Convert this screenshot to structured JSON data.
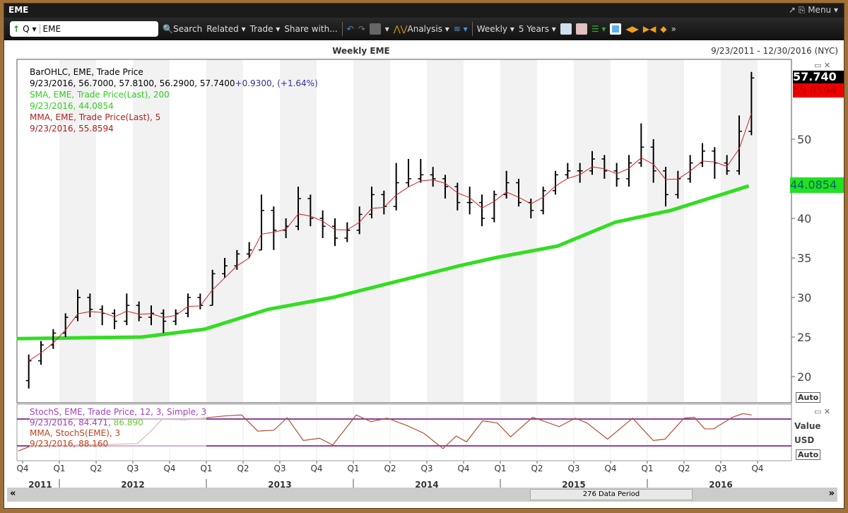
{
  "window": {
    "title": "EME",
    "menu": "Menu"
  },
  "toolbar": {
    "ticker": "EME",
    "quote_mode": "Q",
    "search": "Search",
    "related": "Related",
    "trade": "Trade",
    "share": "Share with...",
    "analysis": "Analysis",
    "period": "Weekly",
    "range": "5 Years"
  },
  "header": {
    "title": "Weekly EME",
    "date_range": "9/23/2011 - 12/30/2016 (NYC)"
  },
  "legend": {
    "price_title": "BarOHLC, EME, Trade Price",
    "price_values": "9/23/2016, 56.7000, 57.8100, 56.2900, 57.7400",
    "price_change": "+0.9300, (+1.64%)",
    "sma_title": "SMA, EME, Trade Price(Last),  200",
    "sma_value": "9/23/2016, 44.0854",
    "mma_title": "MMA, EME, Trade Price(Last),  5",
    "mma_value": "9/23/2016, 55.8594",
    "stoch_title": "StochS, EME, Trade Price,  12, 3, Simple, 3",
    "stoch_value_a": "9/23/2016, 84.471,",
    "stoch_value_b": "86.890",
    "stoch_mma_title": "MMA, StochS(EME),  3",
    "stoch_mma_value": "9/23/2016, 88.160"
  },
  "axis": {
    "last_price": "57.740",
    "mma_tag": "55.8594",
    "sma_tag": "44.0854",
    "auto": "Auto",
    "lower_value": "Value",
    "lower_usd": "USD"
  },
  "footer": {
    "data_period": "276 Data Period"
  },
  "colors": {
    "price": "#000000",
    "sma": "#33dd22",
    "mma": "#cc2222",
    "stoch": "#b05030",
    "band": "#9040a0"
  },
  "chart_data": {
    "type": "ohlc",
    "title": "Weekly EME",
    "frequency_shown": "monthly approximation of weekly bars",
    "start_month": "2011-10",
    "ylim": [
      18,
      59
    ],
    "yticks": [
      20,
      25,
      30,
      35,
      40,
      50
    ],
    "xticks": [
      "Q4",
      "Q1",
      "Q2",
      "Q3",
      "Q4",
      "Q1",
      "Q2",
      "Q3",
      "Q4",
      "Q1",
      "Q2",
      "Q3",
      "Q4",
      "Q1",
      "Q2",
      "Q3",
      "Q4",
      "Q1",
      "Q2",
      "Q3",
      "Q4"
    ],
    "years": [
      "2011",
      "2012",
      "2013",
      "2014",
      "2015",
      "2016"
    ],
    "ohlc": [
      [
        19.5,
        22.8,
        18.5,
        22
      ],
      [
        22,
        24.5,
        21.5,
        24
      ],
      [
        24,
        26,
        23.5,
        25.5
      ],
      [
        25.5,
        28,
        25,
        27.5
      ],
      [
        27.5,
        31,
        27,
        30
      ],
      [
        30,
        30.5,
        27.5,
        28.5
      ],
      [
        28.5,
        29,
        26.5,
        28
      ],
      [
        28,
        28.5,
        26,
        27
      ],
      [
        27,
        30.5,
        26.5,
        29
      ],
      [
        29,
        29.5,
        27,
        27.5
      ],
      [
        27.5,
        29,
        26.5,
        28
      ],
      [
        28,
        28.5,
        25.5,
        27
      ],
      [
        27,
        28.5,
        26.5,
        28
      ],
      [
        28,
        30.5,
        27.5,
        30
      ],
      [
        30,
        30.5,
        28.5,
        29
      ],
      [
        29,
        33.5,
        29,
        33
      ],
      [
        33,
        35,
        32.5,
        34
      ],
      [
        34,
        36,
        33.5,
        35.5
      ],
      [
        35.5,
        37,
        35,
        36
      ],
      [
        36,
        43,
        36,
        41
      ],
      [
        41,
        41.5,
        36,
        38.5
      ],
      [
        38.5,
        40,
        37.5,
        39
      ],
      [
        39,
        44,
        38.5,
        42.5
      ],
      [
        42.5,
        43,
        39,
        40
      ],
      [
        40,
        41,
        37.5,
        39
      ],
      [
        39,
        40,
        36.5,
        37.5
      ],
      [
        37.5,
        39.5,
        37,
        38.5
      ],
      [
        38.5,
        41.5,
        38,
        40.5
      ],
      [
        40.5,
        44,
        40,
        43
      ],
      [
        43,
        43.5,
        40.5,
        41.5
      ],
      [
        41.5,
        47,
        41,
        44.5
      ],
      [
        44.5,
        47.5,
        44,
        45
      ],
      [
        45,
        47.5,
        44.5,
        45.5
      ],
      [
        45.5,
        46.5,
        44,
        45
      ],
      [
        45,
        45.5,
        42.5,
        44
      ],
      [
        44,
        44.5,
        41,
        42
      ],
      [
        42,
        44,
        40.5,
        42
      ],
      [
        42,
        43,
        39,
        40
      ],
      [
        40,
        43.5,
        39.5,
        43
      ],
      [
        43,
        46,
        42.5,
        44.5
      ],
      [
        44.5,
        45,
        41.5,
        42
      ],
      [
        42,
        42.5,
        40,
        41
      ],
      [
        41,
        44,
        40.5,
        43.5
      ],
      [
        43.5,
        46,
        43,
        45.5
      ],
      [
        45.5,
        47,
        45,
        46
      ],
      [
        46,
        47,
        44.5,
        46
      ],
      [
        46,
        48.5,
        45.5,
        47.5
      ],
      [
        47.5,
        48,
        45,
        46
      ],
      [
        46,
        47,
        44,
        45
      ],
      [
        45,
        48,
        44,
        47
      ],
      [
        47,
        52,
        46.5,
        49
      ],
      [
        49,
        50,
        44.5,
        46
      ],
      [
        46,
        46.5,
        41.5,
        43
      ],
      [
        43,
        46,
        42.5,
        45
      ],
      [
        45,
        48,
        44.5,
        47
      ],
      [
        47,
        49.5,
        46.5,
        48.5
      ],
      [
        48.5,
        49,
        45,
        47
      ],
      [
        47,
        48,
        45.5,
        46
      ],
      [
        46,
        53,
        45.5,
        51
      ],
      [
        51,
        58.5,
        50.5,
        57.74
      ]
    ],
    "sma200": [
      [
        2011.71,
        24.8
      ],
      [
        2012.56,
        25
      ],
      [
        2012.99,
        26
      ],
      [
        2013.42,
        28.5
      ],
      [
        2013.86,
        30
      ],
      [
        2014.29,
        32
      ],
      [
        2014.72,
        34
      ],
      [
        2014.96,
        35
      ],
      [
        2015.39,
        36.5
      ],
      [
        2015.78,
        39.5
      ],
      [
        2016.16,
        41
      ],
      [
        2016.69,
        44.09
      ]
    ],
    "stoch": [
      [
        2011.72,
        8.5
      ],
      [
        2011.8,
        19
      ],
      [
        2012.53,
        25
      ],
      [
        2012.63,
        55
      ],
      [
        2012.7,
        80
      ],
      [
        2012.85,
        78
      ],
      [
        2013.13,
        87
      ],
      [
        2013.24,
        89
      ],
      [
        2013.35,
        53
      ],
      [
        2013.46,
        55
      ],
      [
        2013.55,
        83
      ],
      [
        2013.66,
        32
      ],
      [
        2013.77,
        37
      ],
      [
        2013.86,
        22
      ],
      [
        2014.02,
        89
      ],
      [
        2014.12,
        74
      ],
      [
        2014.23,
        82
      ],
      [
        2014.36,
        66
      ],
      [
        2014.48,
        48
      ],
      [
        2014.61,
        14
      ],
      [
        2014.7,
        42
      ],
      [
        2014.77,
        29
      ],
      [
        2014.88,
        76
      ],
      [
        2014.98,
        71
      ],
      [
        2015.07,
        40
      ],
      [
        2015.22,
        84
      ],
      [
        2015.4,
        63
      ],
      [
        2015.51,
        82
      ],
      [
        2015.59,
        71
      ],
      [
        2015.73,
        35
      ],
      [
        2015.9,
        82
      ],
      [
        2016.04,
        32
      ],
      [
        2016.12,
        35
      ],
      [
        2016.25,
        82
      ],
      [
        2016.32,
        84
      ],
      [
        2016.39,
        58
      ],
      [
        2016.45,
        58
      ],
      [
        2016.58,
        84
      ],
      [
        2016.65,
        92
      ],
      [
        2016.71,
        89
      ]
    ],
    "stoch_bands": [
      80,
      20
    ]
  }
}
